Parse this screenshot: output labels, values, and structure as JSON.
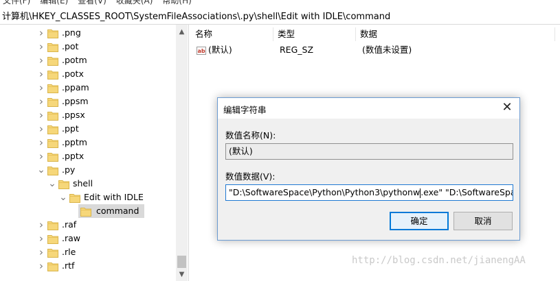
{
  "menubar": {
    "items": [
      "文件(F)",
      "编辑(E)",
      "查看(V)",
      "收藏夹(A)",
      "帮助(H)"
    ]
  },
  "address": {
    "path": "计算机\\HKEY_CLASSES_ROOT\\SystemFileAssociations\\.py\\shell\\Edit with IDLE\\command"
  },
  "tree": {
    "items": [
      {
        "label": ".png",
        "expanded": false
      },
      {
        "label": ".pot",
        "expanded": false
      },
      {
        "label": ".potm",
        "expanded": false
      },
      {
        "label": ".potx",
        "expanded": false
      },
      {
        "label": ".ppam",
        "expanded": false
      },
      {
        "label": ".ppsm",
        "expanded": false
      },
      {
        "label": ".ppsx",
        "expanded": false
      },
      {
        "label": ".ppt",
        "expanded": false
      },
      {
        "label": ".pptm",
        "expanded": false
      },
      {
        "label": ".pptx",
        "expanded": false
      },
      {
        "label": ".py",
        "expanded": true
      },
      {
        "label": "shell",
        "expanded": true
      },
      {
        "label": "Edit with IDLE",
        "expanded": true
      },
      {
        "label": "command",
        "expanded": null,
        "selected": true
      },
      {
        "label": ".raf",
        "expanded": false
      },
      {
        "label": ".raw",
        "expanded": false
      },
      {
        "label": ".rle",
        "expanded": false
      },
      {
        "label": ".rtf",
        "expanded": false
      }
    ]
  },
  "list": {
    "columns": [
      "名称",
      "类型",
      "数据"
    ],
    "rows": [
      {
        "icon": "string-value-icon",
        "name": "(默认)",
        "type": "REG_SZ",
        "data": "(数值未设置)"
      }
    ]
  },
  "dialog": {
    "title": "编辑字符串",
    "close_glyph": "✕",
    "name_label": "数值名称(N):",
    "name_value": "(默认)",
    "data_label": "数值数据(V):",
    "data_value_before_caret": "\"D:\\SoftwareSpace\\Python\\Python3\\pythonw",
    "data_value_after_caret": ".exe\" \"D:\\SoftwareSpace\\Py",
    "ok_label": "确定",
    "cancel_label": "取消"
  },
  "watermark": "http://blog.csdn.net/jianengAA",
  "colors": {
    "accent": "#0078d7",
    "folder": "#f6d77a",
    "selection": "#d9d9d9"
  }
}
